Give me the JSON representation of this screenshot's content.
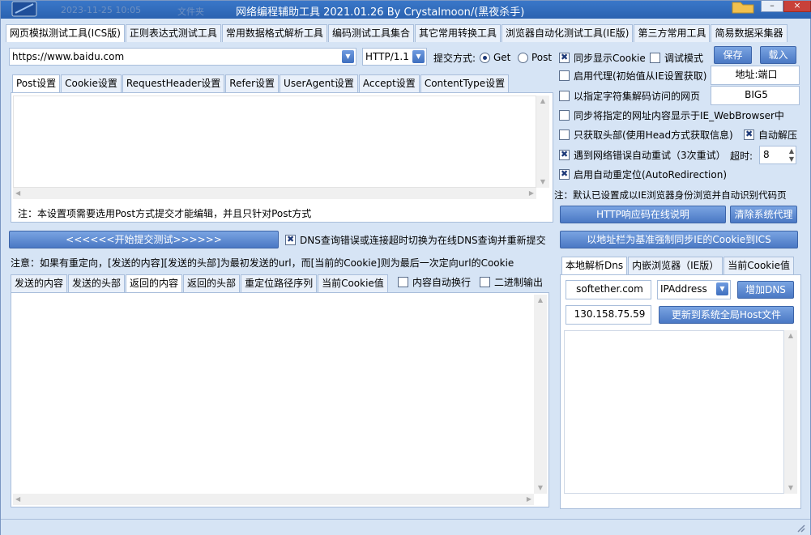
{
  "window": {
    "title": "网络编程辅助工具  2021.01.26  By Crystalmoon/(黑夜杀手)",
    "ghost_date": "2023-11-25 10:05",
    "ghost_label": "文件夹",
    "minimize_label": "–",
    "close_label": "×"
  },
  "main_tabs": [
    "网页模拟测试工具(ICS版)",
    "正则表达式测试工具",
    "常用数据格式解析工具",
    "编码测试工具集合",
    "其它常用转换工具",
    "浏览器自动化测试工具(IE版)",
    "第三方常用工具",
    "简易数据采集器"
  ],
  "request": {
    "url": "https://www.baidu.com",
    "http_version": "HTTP/1.1",
    "submit_method_label": "提交方式:",
    "method_get": "Get",
    "method_post": "Post",
    "sync_cookie": "同步显示Cookie",
    "debug_mode": "调试模式",
    "save_label": "保存",
    "load_label": "载入"
  },
  "settings_tabs": [
    "Post设置",
    "Cookie设置",
    "RequestHeader设置",
    "Refer设置",
    "UserAgent设置",
    "Accept设置",
    "ContentType设置"
  ],
  "post_note": "注：本设置项需要选用Post方式提交才能编辑，并且只针对Post方式",
  "options": {
    "proxy": "启用代理(初始值从IE设置获取)",
    "proxy_addr": "地址:端口",
    "charset": "以指定字符集解码访问的网页",
    "charset_value": "BIG5",
    "sync_ie": "同步将指定的网址内容显示于IE_WebBrowser中",
    "head_only": "只获取头部(使用Head方式获取信息)",
    "auto_decompress": "自动解压",
    "retry": "遇到网络错误自动重试（3次重试）",
    "timeout_label": "超时:",
    "timeout_value": "8",
    "auto_redirect": "启用自动重定位(AutoRedirection)",
    "ie_note": "注：默认已设置成以IE浏览器身份浏览并自动识别代码页",
    "http_code_button": "HTTP响应码在线说明",
    "clear_proxy_button": "清除系统代理"
  },
  "submit": {
    "start_button": "<<<<<<开始提交测试>>>>>>",
    "dns_fallback": "DNS查询错误或连接超时切换为在线DNS查询并重新提交",
    "sync_ie_cookie_button": "以地址栏为基准强制同步IE的Cookie到ICS"
  },
  "redirect_note": "注意：如果有重定向，[发送的内容][发送的头部]为最初发送的url，而[当前的Cookie]则为最后一次定向url的Cookie",
  "result_tabs": [
    "发送的内容",
    "发送的头部",
    "返回的内容",
    "返回的头部",
    "重定位路径序列",
    "当前Cookie值"
  ],
  "result_opts": {
    "wrap": "内容自动换行",
    "binary": "二进制输出"
  },
  "dns": {
    "tabs": [
      "本地解析Dns",
      "内嵌浏览器（IE版）",
      "当前Cookie值"
    ],
    "domain": "softether.com",
    "type": "IPAddress",
    "add_button": "增加DNS",
    "ip": "130.158.75.59",
    "update_hosts_button": "更新到系统全局Host文件"
  },
  "colors": {
    "accent": "#4a78c4",
    "window_bg": "#d6e4f5",
    "title_bar": "#2a62b0"
  }
}
